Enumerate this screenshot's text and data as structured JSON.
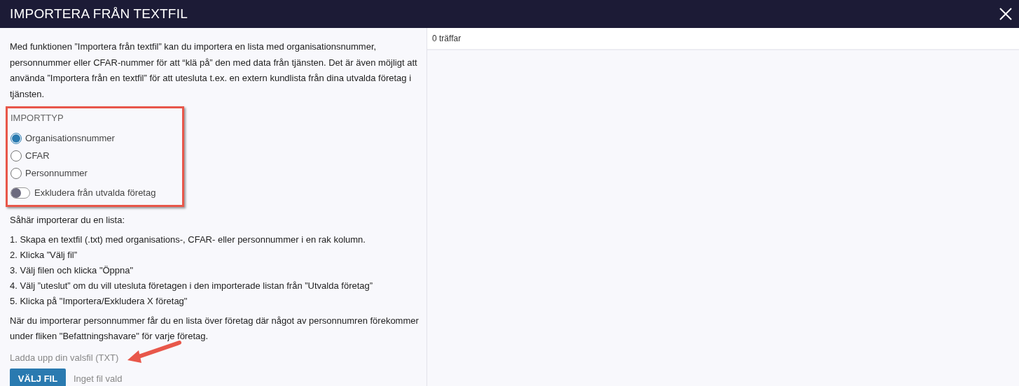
{
  "window": {
    "title": "IMPORTERA FRÅN TEXTFIL"
  },
  "intro": "Med funktionen ”Importera från textfil” kan du importera en lista med organisationsnummer, personnummer eller CFAR-nummer för att “klä på” den med data från tjänsten. Det är även möjligt att använda ”Importera från en textfil” för att utesluta t.ex. en extern kundlista från dina utvalda företag i tjänsten.",
  "import_type": {
    "label": "IMPORTTYP",
    "options": [
      {
        "label": "Organisationsnummer",
        "selected": true
      },
      {
        "label": "CFAR",
        "selected": false
      },
      {
        "label": "Personnummer",
        "selected": false
      }
    ],
    "exclude": {
      "label": "Exkludera från utvalda företag",
      "on": false
    }
  },
  "howto_heading": "Såhär importerar du en lista:",
  "steps": [
    "1. Skapa en textfil (.txt) med organisations-, CFAR- eller personnummer i en rak kolumn.",
    "2. Klicka ”Välj fil”",
    "3. Välj filen och klicka \"Öppna\"",
    "4. Välj ”uteslut” om du vill utesluta företagen i den importerade listan från ”Utvalda företag”",
    "5. Klicka på \"Importera/Exkludera X företag\""
  ],
  "note": "När du importerar personnummer får du en lista över företag där något av personnumren förekommer under fliken \"Befattningshavare\" för varje företag.",
  "upload": {
    "label": "Ladda upp din valsfil (TXT)",
    "button": "VÄLJ FIL",
    "status": "Inget fil vald"
  },
  "results": {
    "count": "0 träffar"
  }
}
